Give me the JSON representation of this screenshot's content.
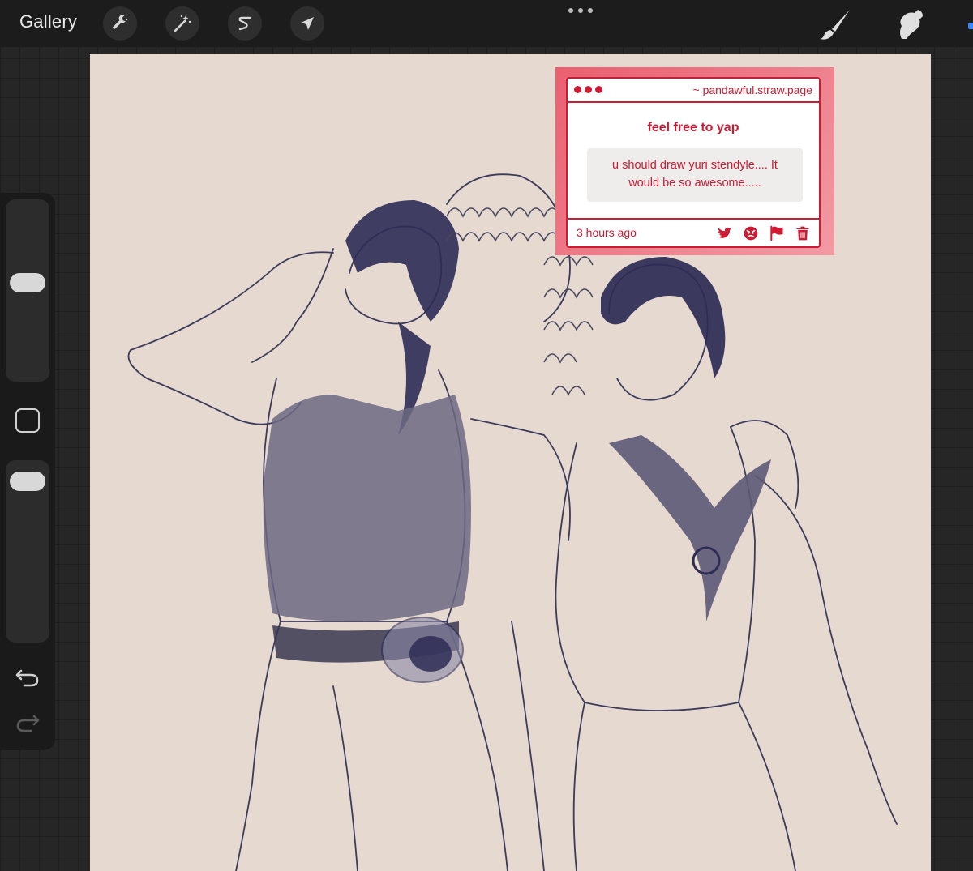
{
  "app": {
    "gallery_label": "Gallery"
  },
  "toolbar": {
    "left_tools": [
      {
        "icon": "wrench-icon",
        "name": "actions"
      },
      {
        "icon": "magic-wand-icon",
        "name": "adjustments"
      },
      {
        "icon": "selection-s-icon",
        "name": "selection"
      },
      {
        "icon": "arrow-cursor-icon",
        "name": "transform"
      }
    ],
    "right_tools": [
      {
        "icon": "brush-icon",
        "name": "paint"
      },
      {
        "icon": "smudge-icon",
        "name": "smudge"
      }
    ]
  },
  "sidebar": {
    "brush_size_level": 0.55,
    "opacity_level": 0.95,
    "modify_button_icon": "square-icon",
    "undo_icon": "undo-icon",
    "redo_icon": "redo-icon"
  },
  "ask_card": {
    "domain": "~ pandawful.straw.page",
    "title": "feel free to yap",
    "message": "u should draw yuri stendyle.... It would be so awesome.....",
    "time": "3 hours ago",
    "icons": [
      "twitter-icon",
      "angry-face-icon",
      "flag-icon",
      "trash-icon"
    ]
  },
  "colors": {
    "accent_red": "#cc1b33",
    "canvas_bg": "#e6d9d0",
    "ui_dark": "#1c1c1c"
  }
}
